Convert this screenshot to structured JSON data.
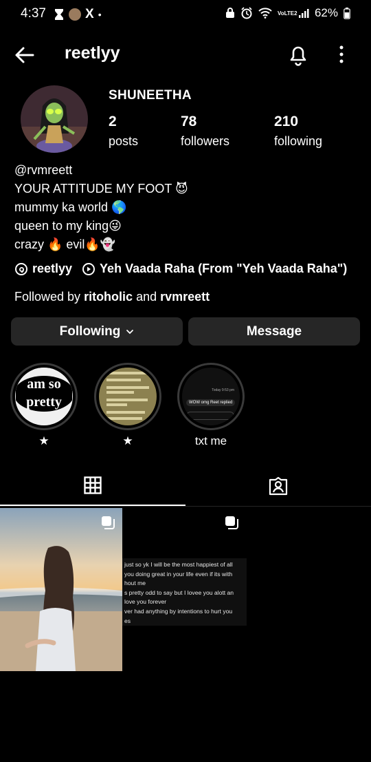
{
  "status_bar": {
    "time": "4:37",
    "battery": "62%",
    "notif_x": "X",
    "notif_dot": "•",
    "volte": "VoLTE2"
  },
  "header": {
    "username": "reetlyy",
    "icons": [
      "back-arrow-icon",
      "bell-icon",
      "more-vertical-icon"
    ]
  },
  "profile": {
    "full_name": "SHUNEETHA",
    "stats": [
      {
        "value": "2",
        "label": "posts"
      },
      {
        "value": "78",
        "label": "followers"
      },
      {
        "value": "210",
        "label": "following"
      }
    ],
    "bio": [
      "@rvmreett",
      "YOUR ATTITUDE MY FOOT 😈",
      "mummy ka world 🌎",
      "queen to my king😜",
      "crazy 🔥 evil🔥👻"
    ],
    "threads_handle": "reetlyy",
    "song": "Yeh Vaada Raha (From \"Yeh Vaada Raha\")",
    "followed_by": {
      "prefix": "Followed by ",
      "first": "ritoholic",
      "conj": " and ",
      "second": "rvmreett"
    }
  },
  "buttons": {
    "following": "Following",
    "message": "Message"
  },
  "highlights": [
    {
      "label": "★",
      "cover_text": "am so pretty"
    },
    {
      "label": "★"
    },
    {
      "label": "txt me",
      "cover_text_1": "WOW omg Reet replied",
      "cover_text_2": "Today 9:53 pm"
    }
  ],
  "tabs": [
    "grid-icon",
    "tagged-icon"
  ],
  "posts": {
    "text_post_lines": [
      "just so yk I will be the most happiest of all",
      "you doing great in your life even if its with",
      "hout me",
      "s pretty odd to say but I lovee you alott an",
      "love you forever",
      "ver had anything by intentions to hurt you",
      "es"
    ]
  },
  "colors": {
    "background": "#000000",
    "button_bg": "#262626",
    "text": "#ffffff",
    "ring": "#3a3a3a"
  }
}
